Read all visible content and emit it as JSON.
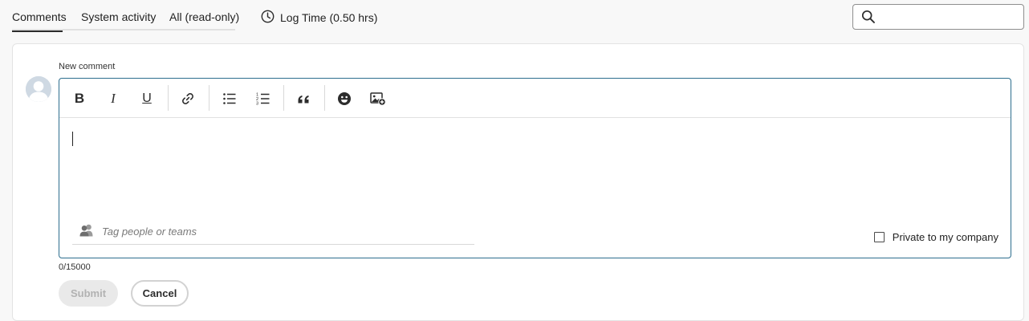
{
  "tabs": {
    "items": [
      {
        "label": "Comments",
        "active": true
      },
      {
        "label": "System activity",
        "active": false
      },
      {
        "label": "All (read-only)",
        "active": false
      }
    ],
    "log_time": {
      "label": "Log Time (0.50 hrs)",
      "icon": "clock-icon"
    }
  },
  "search": {
    "placeholder": "",
    "value": "",
    "icon": "search-icon"
  },
  "comment": {
    "label": "New comment",
    "toolbar": {
      "bold": "B",
      "italic": "I",
      "underline": "U",
      "icons": [
        "bold-icon",
        "italic-icon",
        "underline-icon",
        "link-icon",
        "bulleted-list-icon",
        "numbered-list-icon",
        "quote-icon",
        "emoji-icon",
        "insert-image-icon"
      ]
    },
    "body_value": "",
    "tag_placeholder": "Tag people or teams",
    "private_label": "Private to my company",
    "private_checked": false,
    "counter": "0/15000",
    "submit_label": "Submit",
    "cancel_label": "Cancel"
  },
  "colors": {
    "editor_border": "#2d6e8e",
    "active_tab_underline": "#2c2c2c",
    "avatar": "#cfd9e3"
  }
}
